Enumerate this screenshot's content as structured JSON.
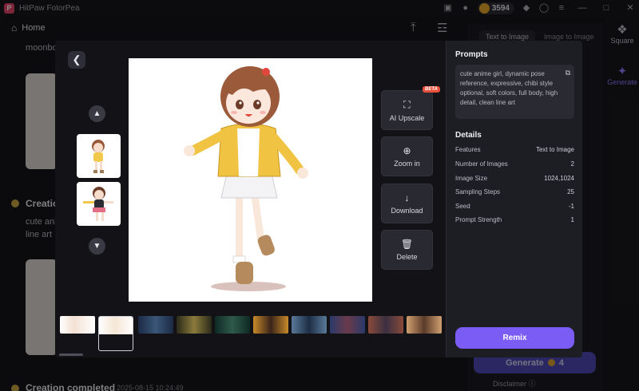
{
  "app": {
    "title": "HitPaw FotorPea",
    "credits": "3594"
  },
  "background": {
    "home_label": "Home",
    "partial_text_1": "moonbo",
    "creation_heading": "Creation",
    "creation_text_1": "cute ani",
    "creation_text_2": "line art",
    "creation_completed": "Creation completed",
    "creation_timestamp": "2025-08-15 10:24:49",
    "tab_text_to_image": "Text to Image",
    "tab_image_to_image": "Image to Image",
    "rail_square": "Square",
    "rail_generate": "Generate",
    "generate_label": "Generate",
    "generate_cost": "4",
    "disclaimer": "Disclaimer"
  },
  "modal": {
    "actions": {
      "upscale": "AI Upscale",
      "beta": "BETA",
      "zoom": "Zoom in",
      "download": "Download",
      "delete": "Delete"
    },
    "prompts_title": "Prompts",
    "prompt_text": "cute anime girl, dynamic pose reference, expressive, chibi style optional, soft colors, full body, high detail, clean line art",
    "details_title": "Details",
    "details": [
      {
        "label": "Features",
        "value": "Text to Image"
      },
      {
        "label": "Number of Images",
        "value": "2"
      },
      {
        "label": "Image Size",
        "value": "1024,1024"
      },
      {
        "label": "Sampling Steps",
        "value": "25"
      },
      {
        "label": "Seed",
        "value": "-1"
      },
      {
        "label": "Prompt Strength",
        "value": "1"
      }
    ],
    "remix_label": "Remix"
  },
  "icons": {
    "back": "chevron-left-icon",
    "up": "chevron-up-icon",
    "down": "chevron-down-icon",
    "upscale": "expand-icon",
    "zoom": "zoom-in-icon",
    "download": "download-icon",
    "delete": "trash-icon",
    "copy": "copy-icon"
  },
  "colors": {
    "accent": "#7b5cf5",
    "beta": "#e8503c"
  }
}
